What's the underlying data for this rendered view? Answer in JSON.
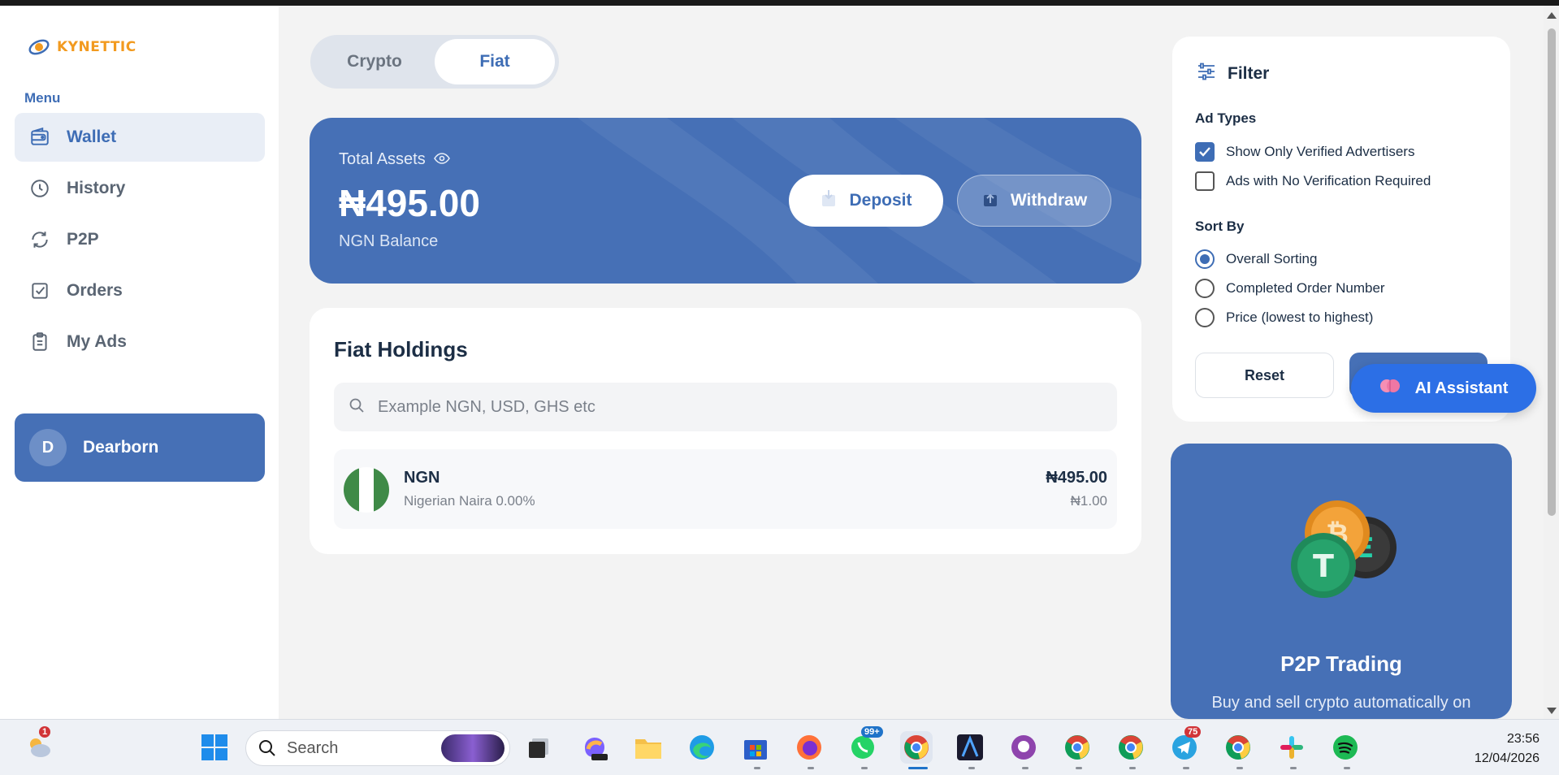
{
  "app": {
    "logo_text": "KYNETTIC"
  },
  "sidebar": {
    "menu_label": "Menu",
    "items": [
      {
        "label": "Wallet",
        "icon": "wallet-icon",
        "active": true
      },
      {
        "label": "History",
        "icon": "clock-icon",
        "active": false
      },
      {
        "label": "P2P",
        "icon": "refresh-icon",
        "active": false
      },
      {
        "label": "Orders",
        "icon": "checkbox-icon",
        "active": false
      },
      {
        "label": "My Ads",
        "icon": "clipboard-icon",
        "active": false
      }
    ],
    "user": {
      "initial": "D",
      "name": "Dearborn"
    }
  },
  "tabs": {
    "crypto": "Crypto",
    "fiat": "Fiat",
    "active": "Fiat"
  },
  "assets": {
    "label": "Total Assets",
    "value": "₦495.00",
    "sub": "NGN Balance",
    "deposit_label": "Deposit",
    "withdraw_label": "Withdraw"
  },
  "holdings": {
    "title": "Fiat Holdings",
    "search_placeholder": "Example NGN, USD, GHS etc",
    "rows": [
      {
        "code": "NGN",
        "desc": "Nigerian Naira 0.00%",
        "amount": "₦495.00",
        "rate": "₦1.00"
      }
    ]
  },
  "filter": {
    "title": "Filter",
    "ad_types_label": "Ad Types",
    "ad_types": [
      {
        "label": "Show Only Verified Advertisers",
        "checked": true
      },
      {
        "label": "Ads with No Verification Required",
        "checked": false
      }
    ],
    "sort_label": "Sort By",
    "sort_options": [
      {
        "label": "Overall Sorting",
        "selected": true
      },
      {
        "label": "Completed Order Number",
        "selected": false
      },
      {
        "label": "Price (lowest to highest)",
        "selected": false
      }
    ],
    "reset_label": "Reset"
  },
  "ai_assistant": {
    "label": "AI Assistant"
  },
  "promo": {
    "title": "P2P Trading",
    "desc": "Buy and sell crypto automatically on"
  },
  "taskbar": {
    "search_label": "Search",
    "weather_badge": "1",
    "whatsapp_badge": "99+",
    "telegram_badge": "75",
    "time": "23:56",
    "date": "12/04/2026"
  },
  "colors": {
    "brand": "#4670b6",
    "accent": "#3e6db5",
    "logo": "#f29a1f"
  }
}
